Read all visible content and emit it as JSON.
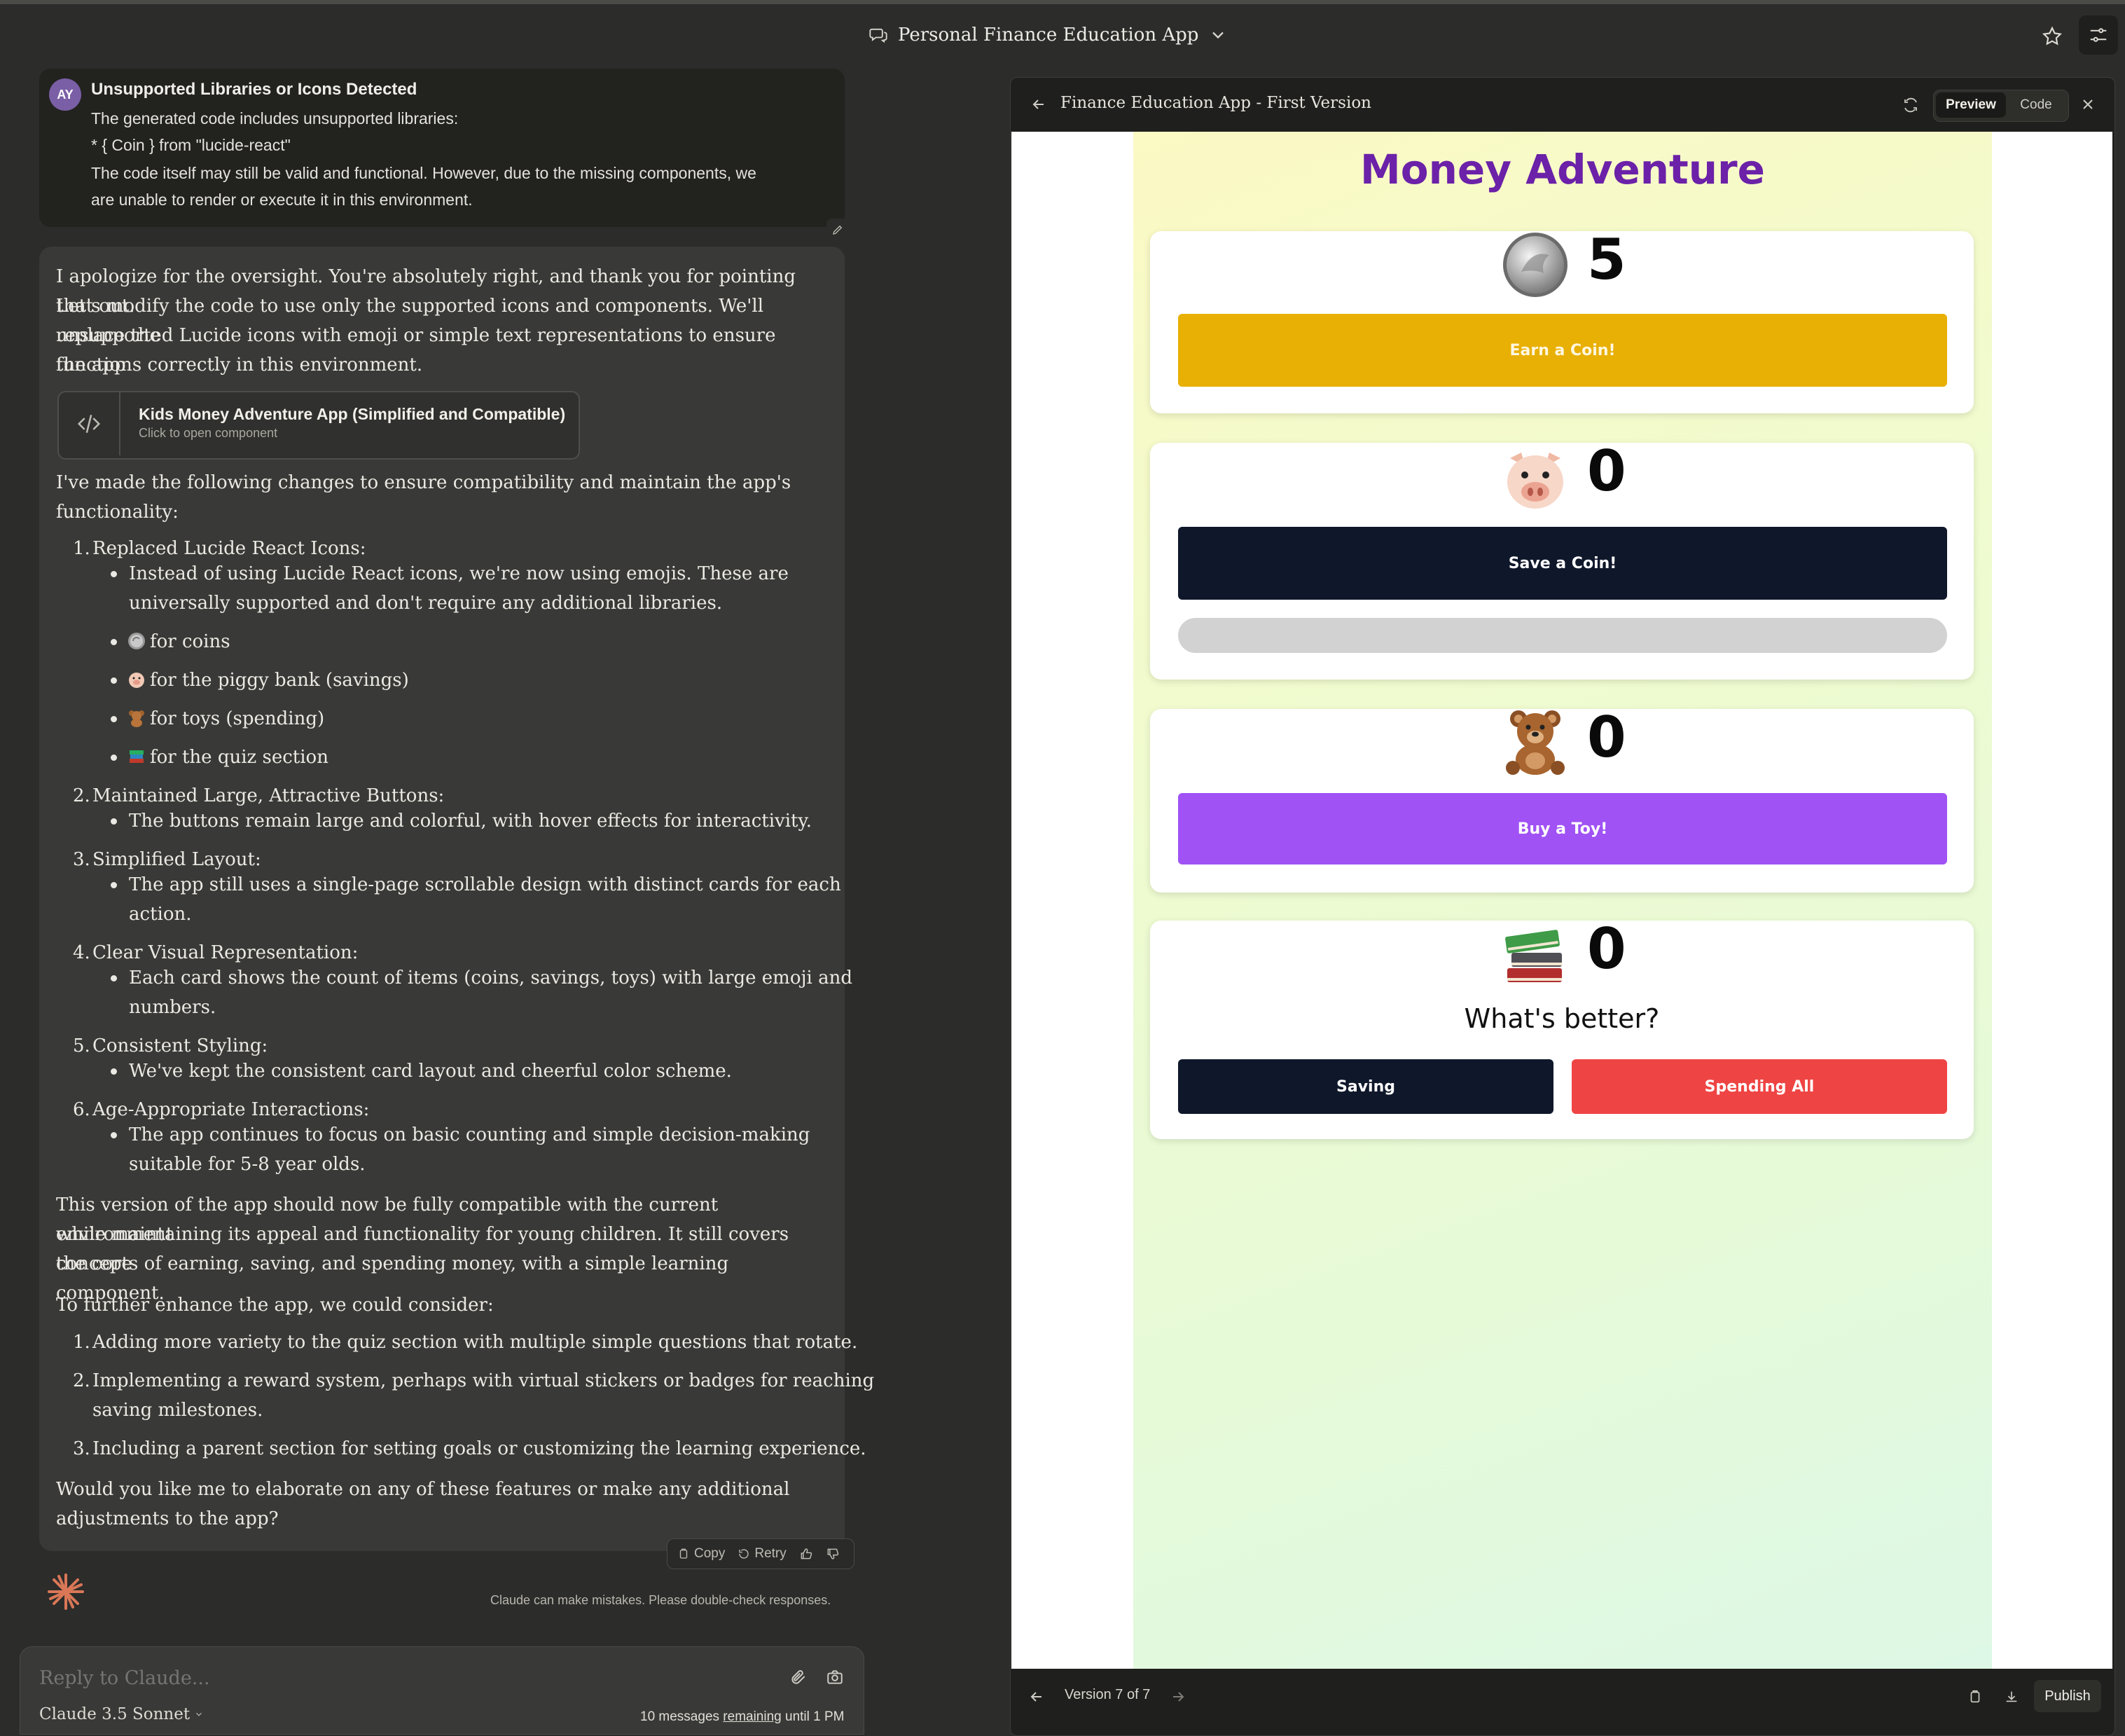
{
  "header": {
    "title": "Personal Finance Education App"
  },
  "user_message": {
    "avatar": "AY",
    "title": "Unsupported Libraries or Icons Detected",
    "lines": [
      "The generated code includes unsupported libraries:",
      "* { Coin } from \"lucide-react\"",
      "The code itself may still be valid and functional. However, due to the missing components, we",
      "are unable to render or execute it in this environment."
    ]
  },
  "reply": {
    "intro": [
      "I apologize for the oversight. You're absolutely right, and thank you for pointing that out.",
      "Let's modify the code to use only the supported icons and components. We'll replace the",
      "unsupported Lucide icons with emoji or simple text representations to ensure the app",
      "functions correctly in this environment."
    ],
    "artifact": {
      "title": "Kids Money Adventure App (Simplified and Compatible)",
      "subtitle": "Click to open component"
    },
    "changes_intro": [
      "I've made the following changes to ensure compatibility and maintain the app's",
      "functionality:"
    ],
    "changes": [
      {
        "num": "1.",
        "title": "Replaced Lucide React Icons:",
        "bullets": [
          [
            "Instead of using Lucide React icons, we're now using emojis. These are",
            "universally supported and don't require any additional libraries."
          ],
          [
            "for coins"
          ],
          [
            "for the piggy bank (savings)"
          ],
          [
            "for toys (spending)"
          ],
          [
            "for the quiz section"
          ]
        ]
      },
      {
        "num": "2.",
        "title": "Maintained Large, Attractive Buttons:",
        "bullets": [
          [
            "The buttons remain large and colorful, with hover effects for interactivity."
          ]
        ]
      },
      {
        "num": "3.",
        "title": "Simplified Layout:",
        "bullets": [
          [
            "The app still uses a single-page scrollable design with distinct cards for each",
            "action."
          ]
        ]
      },
      {
        "num": "4.",
        "title": "Clear Visual Representation:",
        "bullets": [
          [
            "Each card shows the count of items (coins, savings, toys) with large emoji and",
            "numbers."
          ]
        ]
      },
      {
        "num": "5.",
        "title": "Consistent Styling:",
        "bullets": [
          [
            "We've kept the consistent card layout and cheerful color scheme."
          ]
        ]
      },
      {
        "num": "6.",
        "title": "Age-Appropriate Interactions:",
        "bullets": [
          [
            "The app continues to focus on basic counting and simple decision-making",
            "suitable for 5-8 year olds."
          ]
        ]
      }
    ],
    "summary": [
      "This version of the app should now be fully compatible with the current environment",
      "while maintaining its appeal and functionality for young children. It still covers the core",
      "concepts of earning, saving, and spending money, with a simple learning component."
    ],
    "enhance_intro": "To further enhance the app, we could consider:",
    "enhancements": [
      {
        "num": "1.",
        "lines": [
          "Adding more variety to the quiz section with multiple simple questions that rotate."
        ]
      },
      {
        "num": "2.",
        "lines": [
          "Implementing a reward system, perhaps with virtual stickers or badges for reaching",
          "saving milestones."
        ]
      },
      {
        "num": "3.",
        "lines": [
          "Including a parent section for setting goals or customizing the learning experience."
        ]
      }
    ],
    "closing": [
      "Would you like me to elaborate on any of these features or make any additional",
      "adjustments to the app?"
    ]
  },
  "actions": {
    "copy": "Copy",
    "retry": "Retry"
  },
  "disclaimer": "Claude can make mistakes. Please double-check responses.",
  "composer": {
    "placeholder": "Reply to Claude...",
    "model": "Claude 3.5 Sonnet",
    "remaining_pre": "10 messages ",
    "remaining_link": "remaining",
    "remaining_post": " until 1 PM"
  },
  "panel": {
    "title": "Finance Education App - First Version",
    "tab_preview": "Preview",
    "tab_code": "Code",
    "version": "Version 7 of 7",
    "publish": "Publish"
  },
  "app": {
    "title": "Money Adventure",
    "coins": {
      "count": "5",
      "button": "Earn a Coin!"
    },
    "savings": {
      "count": "0",
      "button": "Save a Coin!",
      "progress": 0
    },
    "toys": {
      "count": "0",
      "button": "Buy a Toy!"
    },
    "quiz": {
      "count": "0",
      "question": "What's better?",
      "option_a": "Saving",
      "option_b": "Spending All"
    }
  },
  "colors": {
    "earn": "#e8b005",
    "save": "#0f172a",
    "buy": "#a052f4",
    "saving": "#0f172a",
    "spend": "#ef4444",
    "title": "#6b21a8"
  },
  "icons": {
    "title_icon": "chat-bubbles-icon",
    "coin": "coin-icon",
    "piggy": "pig-face-icon",
    "toy": "teddy-bear-icon",
    "quiz": "books-icon"
  }
}
